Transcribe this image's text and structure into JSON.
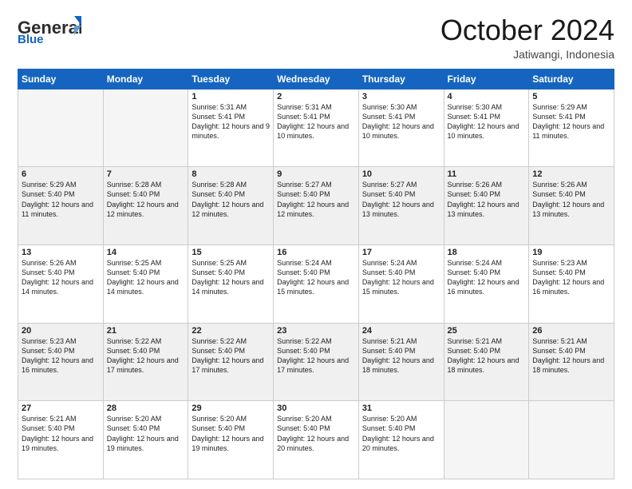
{
  "header": {
    "logo_general": "General",
    "logo_blue": "Blue",
    "month": "October 2024",
    "location": "Jatiwangi, Indonesia"
  },
  "days_of_week": [
    "Sunday",
    "Monday",
    "Tuesday",
    "Wednesday",
    "Thursday",
    "Friday",
    "Saturday"
  ],
  "weeks": [
    {
      "shade": false,
      "days": [
        {
          "num": "",
          "info": "",
          "empty": true
        },
        {
          "num": "",
          "info": "",
          "empty": true
        },
        {
          "num": "1",
          "info": "Sunrise: 5:31 AM\nSunset: 5:41 PM\nDaylight: 12 hours and 9 minutes.",
          "empty": false
        },
        {
          "num": "2",
          "info": "Sunrise: 5:31 AM\nSunset: 5:41 PM\nDaylight: 12 hours and 10 minutes.",
          "empty": false
        },
        {
          "num": "3",
          "info": "Sunrise: 5:30 AM\nSunset: 5:41 PM\nDaylight: 12 hours and 10 minutes.",
          "empty": false
        },
        {
          "num": "4",
          "info": "Sunrise: 5:30 AM\nSunset: 5:41 PM\nDaylight: 12 hours and 10 minutes.",
          "empty": false
        },
        {
          "num": "5",
          "info": "Sunrise: 5:29 AM\nSunset: 5:41 PM\nDaylight: 12 hours and 11 minutes.",
          "empty": false
        }
      ]
    },
    {
      "shade": true,
      "days": [
        {
          "num": "6",
          "info": "Sunrise: 5:29 AM\nSunset: 5:40 PM\nDaylight: 12 hours and 11 minutes.",
          "empty": false
        },
        {
          "num": "7",
          "info": "Sunrise: 5:28 AM\nSunset: 5:40 PM\nDaylight: 12 hours and 12 minutes.",
          "empty": false
        },
        {
          "num": "8",
          "info": "Sunrise: 5:28 AM\nSunset: 5:40 PM\nDaylight: 12 hours and 12 minutes.",
          "empty": false
        },
        {
          "num": "9",
          "info": "Sunrise: 5:27 AM\nSunset: 5:40 PM\nDaylight: 12 hours and 12 minutes.",
          "empty": false
        },
        {
          "num": "10",
          "info": "Sunrise: 5:27 AM\nSunset: 5:40 PM\nDaylight: 12 hours and 13 minutes.",
          "empty": false
        },
        {
          "num": "11",
          "info": "Sunrise: 5:26 AM\nSunset: 5:40 PM\nDaylight: 12 hours and 13 minutes.",
          "empty": false
        },
        {
          "num": "12",
          "info": "Sunrise: 5:26 AM\nSunset: 5:40 PM\nDaylight: 12 hours and 13 minutes.",
          "empty": false
        }
      ]
    },
    {
      "shade": false,
      "days": [
        {
          "num": "13",
          "info": "Sunrise: 5:26 AM\nSunset: 5:40 PM\nDaylight: 12 hours and 14 minutes.",
          "empty": false
        },
        {
          "num": "14",
          "info": "Sunrise: 5:25 AM\nSunset: 5:40 PM\nDaylight: 12 hours and 14 minutes.",
          "empty": false
        },
        {
          "num": "15",
          "info": "Sunrise: 5:25 AM\nSunset: 5:40 PM\nDaylight: 12 hours and 14 minutes.",
          "empty": false
        },
        {
          "num": "16",
          "info": "Sunrise: 5:24 AM\nSunset: 5:40 PM\nDaylight: 12 hours and 15 minutes.",
          "empty": false
        },
        {
          "num": "17",
          "info": "Sunrise: 5:24 AM\nSunset: 5:40 PM\nDaylight: 12 hours and 15 minutes.",
          "empty": false
        },
        {
          "num": "18",
          "info": "Sunrise: 5:24 AM\nSunset: 5:40 PM\nDaylight: 12 hours and 16 minutes.",
          "empty": false
        },
        {
          "num": "19",
          "info": "Sunrise: 5:23 AM\nSunset: 5:40 PM\nDaylight: 12 hours and 16 minutes.",
          "empty": false
        }
      ]
    },
    {
      "shade": true,
      "days": [
        {
          "num": "20",
          "info": "Sunrise: 5:23 AM\nSunset: 5:40 PM\nDaylight: 12 hours and 16 minutes.",
          "empty": false
        },
        {
          "num": "21",
          "info": "Sunrise: 5:22 AM\nSunset: 5:40 PM\nDaylight: 12 hours and 17 minutes.",
          "empty": false
        },
        {
          "num": "22",
          "info": "Sunrise: 5:22 AM\nSunset: 5:40 PM\nDaylight: 12 hours and 17 minutes.",
          "empty": false
        },
        {
          "num": "23",
          "info": "Sunrise: 5:22 AM\nSunset: 5:40 PM\nDaylight: 12 hours and 17 minutes.",
          "empty": false
        },
        {
          "num": "24",
          "info": "Sunrise: 5:21 AM\nSunset: 5:40 PM\nDaylight: 12 hours and 18 minutes.",
          "empty": false
        },
        {
          "num": "25",
          "info": "Sunrise: 5:21 AM\nSunset: 5:40 PM\nDaylight: 12 hours and 18 minutes.",
          "empty": false
        },
        {
          "num": "26",
          "info": "Sunrise: 5:21 AM\nSunset: 5:40 PM\nDaylight: 12 hours and 18 minutes.",
          "empty": false
        }
      ]
    },
    {
      "shade": false,
      "days": [
        {
          "num": "27",
          "info": "Sunrise: 5:21 AM\nSunset: 5:40 PM\nDaylight: 12 hours and 19 minutes.",
          "empty": false
        },
        {
          "num": "28",
          "info": "Sunrise: 5:20 AM\nSunset: 5:40 PM\nDaylight: 12 hours and 19 minutes.",
          "empty": false
        },
        {
          "num": "29",
          "info": "Sunrise: 5:20 AM\nSunset: 5:40 PM\nDaylight: 12 hours and 19 minutes.",
          "empty": false
        },
        {
          "num": "30",
          "info": "Sunrise: 5:20 AM\nSunset: 5:40 PM\nDaylight: 12 hours and 20 minutes.",
          "empty": false
        },
        {
          "num": "31",
          "info": "Sunrise: 5:20 AM\nSunset: 5:40 PM\nDaylight: 12 hours and 20 minutes.",
          "empty": false
        },
        {
          "num": "",
          "info": "",
          "empty": true
        },
        {
          "num": "",
          "info": "",
          "empty": true
        }
      ]
    }
  ]
}
